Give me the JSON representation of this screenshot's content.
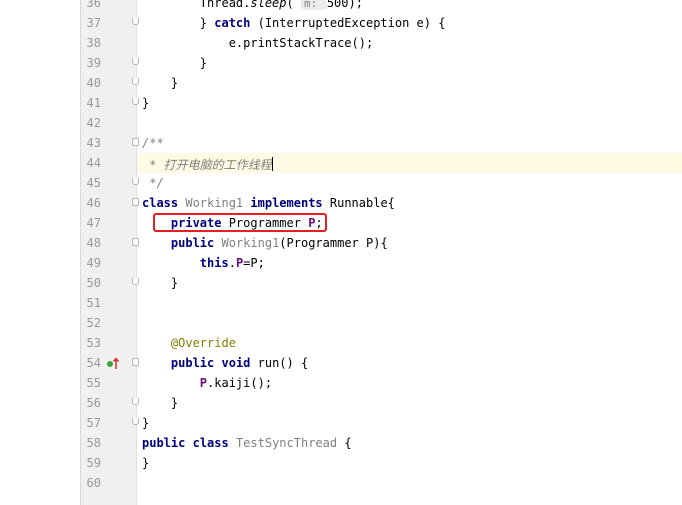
{
  "editor": {
    "lines": [
      {
        "num": "36",
        "caret": false,
        "fold": "none",
        "segments": [
          [
            "",
            "        Thread."
          ],
          [
            "cm-call",
            "sleep"
          ],
          [
            "",
            "( "
          ],
          [
            "hint",
            "m: "
          ],
          [
            "",
            "500);"
          ]
        ]
      },
      {
        "num": "37",
        "caret": false,
        "fold": "end",
        "segments": [
          [
            "",
            "        } "
          ],
          [
            "kw",
            "catch"
          ],
          [
            "",
            " (InterruptedException e) {"
          ]
        ]
      },
      {
        "num": "38",
        "caret": false,
        "fold": "none",
        "segments": [
          [
            "",
            "            e.printStackTrace();"
          ]
        ]
      },
      {
        "num": "39",
        "caret": false,
        "fold": "end",
        "segments": [
          [
            "",
            "        }"
          ]
        ]
      },
      {
        "num": "40",
        "caret": false,
        "fold": "end",
        "segments": [
          [
            "",
            "    }"
          ]
        ]
      },
      {
        "num": "41",
        "caret": false,
        "fold": "end",
        "segments": [
          [
            "",
            "}"
          ]
        ]
      },
      {
        "num": "42",
        "caret": false,
        "fold": "none",
        "segments": [
          [
            "",
            ""
          ]
        ]
      },
      {
        "num": "43",
        "caret": false,
        "fold": "start",
        "segments": [
          [
            "cm",
            "/**"
          ]
        ]
      },
      {
        "num": "44",
        "caret": true,
        "fold": "none",
        "segments": [
          [
            "cm",
            " * 打开电脑的工作线程"
          ],
          [
            "caret",
            ""
          ]
        ]
      },
      {
        "num": "45",
        "caret": false,
        "fold": "end",
        "segments": [
          [
            "cm",
            " */"
          ]
        ]
      },
      {
        "num": "46",
        "caret": false,
        "fold": "start",
        "segments": [
          [
            "kw",
            "class"
          ],
          [
            "",
            " "
          ],
          [
            "gray",
            "Working1"
          ],
          [
            "",
            " "
          ],
          [
            "kw",
            "implements"
          ],
          [
            "",
            " Runnable{"
          ]
        ]
      },
      {
        "num": "47",
        "caret": false,
        "fold": "none",
        "segments": [
          [
            "",
            "    "
          ],
          [
            "kw",
            "private"
          ],
          [
            "",
            " Programmer "
          ],
          [
            "field",
            "P"
          ],
          [
            "",
            ";"
          ]
        ]
      },
      {
        "num": "48",
        "caret": false,
        "fold": "start",
        "segments": [
          [
            "",
            "    "
          ],
          [
            "kw",
            "public"
          ],
          [
            "",
            " "
          ],
          [
            "gray",
            "Working1"
          ],
          [
            "",
            "(Programmer P){"
          ]
        ]
      },
      {
        "num": "49",
        "caret": false,
        "fold": "none",
        "segments": [
          [
            "",
            "        "
          ],
          [
            "kw",
            "this"
          ],
          [
            "",
            "."
          ],
          [
            "field",
            "P"
          ],
          [
            "",
            "=P;"
          ]
        ]
      },
      {
        "num": "50",
        "caret": false,
        "fold": "end",
        "segments": [
          [
            "",
            "    }"
          ]
        ]
      },
      {
        "num": "51",
        "caret": false,
        "fold": "none",
        "segments": [
          [
            "",
            ""
          ]
        ]
      },
      {
        "num": "52",
        "caret": false,
        "fold": "none",
        "segments": [
          [
            "",
            ""
          ]
        ]
      },
      {
        "num": "53",
        "caret": false,
        "fold": "none",
        "segments": [
          [
            "",
            "    "
          ],
          [
            "annot",
            "@Override"
          ]
        ]
      },
      {
        "num": "54",
        "caret": false,
        "fold": "start",
        "segments": [
          [
            "",
            "    "
          ],
          [
            "kw",
            "public"
          ],
          [
            "",
            " "
          ],
          [
            "kw",
            "void"
          ],
          [
            "",
            " run() {"
          ]
        ],
        "override_icon": true
      },
      {
        "num": "55",
        "caret": false,
        "fold": "none",
        "segments": [
          [
            "",
            "        "
          ],
          [
            "field",
            "P"
          ],
          [
            "",
            ".kaiji();"
          ]
        ]
      },
      {
        "num": "56",
        "caret": false,
        "fold": "end",
        "segments": [
          [
            "",
            "    }"
          ]
        ]
      },
      {
        "num": "57",
        "caret": false,
        "fold": "end",
        "segments": [
          [
            "",
            "}"
          ]
        ]
      },
      {
        "num": "58",
        "caret": false,
        "fold": "none",
        "segments": [
          [
            "kw",
            "public"
          ],
          [
            "",
            " "
          ],
          [
            "kw",
            "class"
          ],
          [
            "",
            " "
          ],
          [
            "gray",
            "TestSyncThread"
          ],
          [
            "",
            " {"
          ]
        ]
      },
      {
        "num": "59",
        "caret": false,
        "fold": "none",
        "segments": [
          [
            "",
            "}"
          ]
        ]
      },
      {
        "num": "60",
        "caret": false,
        "fold": "none",
        "segments": [
          [
            "",
            ""
          ]
        ]
      }
    ],
    "icons": {
      "override": "override-method-icon",
      "fold": "fold-marker-icon"
    },
    "colors": {
      "keyword": "#000080",
      "comment": "#808080",
      "annotation": "#808000",
      "field": "#660e7a",
      "highlight_box": "#e5201e",
      "caret_line": "#fffae3"
    }
  }
}
